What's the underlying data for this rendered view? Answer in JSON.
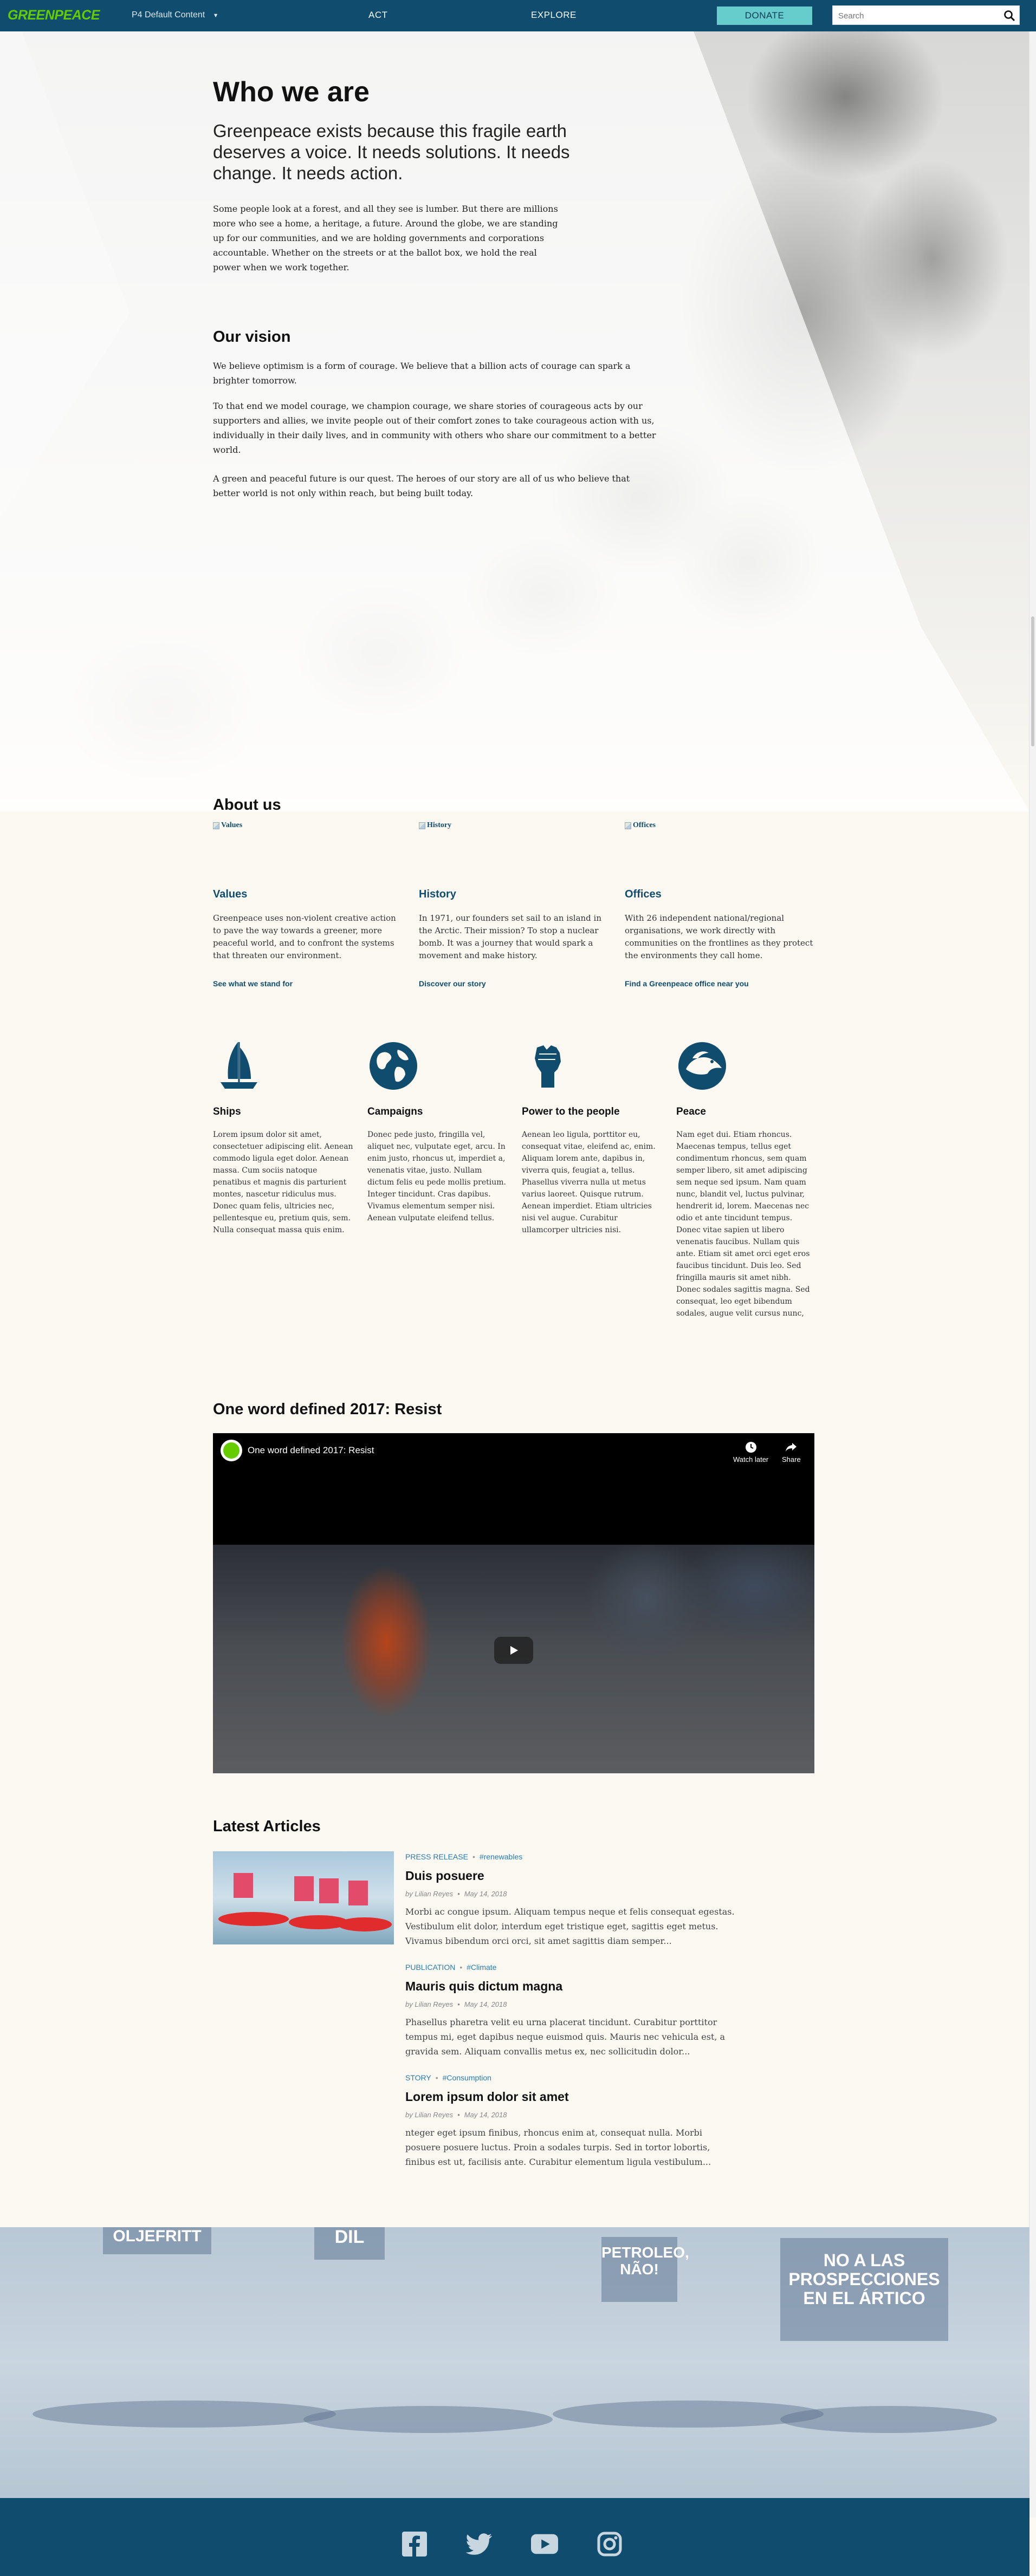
{
  "header": {
    "logo": "GREENPEACE",
    "site_switch": "P4 Default Content",
    "nav": [
      "ACT",
      "EXPLORE"
    ],
    "donate": "DONATE",
    "search_placeholder": "Search"
  },
  "hero": {
    "title": "Who we are",
    "lead": "Greenpeace exists because this fragile earth deserves a voice. It needs solutions. It needs change. It needs action.",
    "intro": "Some people look at a forest, and all they see is lumber. But there are millions more who see a home, a heritage, a future. Around the globe, we are standing up for our communities, and we are holding governments and corporations accountable. Whether on the streets or at the ballot box, we hold the real power when we work together."
  },
  "vision": {
    "heading": "Our vision",
    "paragraphs": [
      "We believe optimism is a form of courage. We believe that a billion acts of courage can spark a brighter tomorrow.",
      "To that end we model courage, we champion courage, we share stories of courageous acts by our supporters and allies, we invite people out of their comfort zones to take courageous action with us, individually in their daily lives, and in community with others who share our commitment to a better world.",
      "A green and peaceful future is our quest. The heroes of our story are all of us who believe that better world is not only within reach, but being built today."
    ]
  },
  "about": {
    "heading": "About us",
    "items": [
      {
        "img_alt": "Values",
        "title": "Values",
        "text": "Greenpeace uses non-violent creative action to pave the way towards a greener, more peaceful world, and to confront the systems that threaten our environment.",
        "link": "See what we stand for"
      },
      {
        "img_alt": "History",
        "title": "History",
        "text": "In 1971, our founders set sail to an island in the Arctic. Their mission? To stop a nuclear bomb. It was a journey that would spark a movement and make history.",
        "link": "Discover our story"
      },
      {
        "img_alt": "Offices",
        "title": "Offices",
        "text": "With 26 independent national/regional organisations, we work directly with communities on the frontlines as they protect the environments they call home.",
        "link": "Find a Greenpeace office near you"
      }
    ]
  },
  "features": [
    {
      "icon": "ship-icon",
      "title": "Ships",
      "text": "Lorem ipsum dolor sit amet, consectetuer adipiscing elit. Aenean commodo ligula eget dolor. Aenean massa. Cum sociis natoque penatibus et magnis dis parturient montes, nascetur ridiculus mus. Donec quam felis, ultricies nec, pellentesque eu, pretium quis, sem. Nulla consequat massa quis enim."
    },
    {
      "icon": "globe-icon",
      "title": "Campaigns",
      "text": "Donec pede justo, fringilla vel, aliquet nec, vulputate eget, arcu. In enim justo, rhoncus ut, imperdiet a, venenatis vitae, justo. Nullam dictum felis eu pede mollis pretium. Integer tincidunt. Cras dapibus. Vivamus elementum semper nisi. Aenean vulputate eleifend tellus."
    },
    {
      "icon": "fist-icon",
      "title": "Power to the people",
      "text": "Aenean leo ligula, porttitor eu, consequat vitae, eleifend ac, enim. Aliquam lorem ante, dapibus in, viverra quis, feugiat a, tellus. Phasellus viverra nulla ut metus varius laoreet. Quisque rutrum. Aenean imperdiet. Etiam ultricies nisi vel augue. Curabitur ullamcorper ultricies nisi."
    },
    {
      "icon": "dove-icon",
      "title": "Peace",
      "text": "Nam eget dui. Etiam rhoncus. Maecenas tempus, tellus eget condimentum rhoncus, sem quam semper libero, sit amet adipiscing sem neque sed ipsum. Nam quam nunc, blandit vel, luctus pulvinar, hendrerit id, lorem. Maecenas nec odio et ante tincidunt tempus. Donec vitae sapien ut libero venenatis faucibus. Nullam quis ante. Etiam sit amet orci eget eros faucibus tincidunt. Duis leo. Sed fringilla mauris sit amet nibh. Donec sodales sagittis magna. Sed consequat, leo eget bibendum sodales, augue velit cursus nunc,"
    }
  ],
  "video": {
    "heading": "One word defined 2017: Resist",
    "title": "One word defined 2017: Resist",
    "watch_later": "Watch later",
    "share": "Share"
  },
  "articles": {
    "heading": "Latest Articles",
    "items": [
      {
        "type": "PRESS RELEASE",
        "tag": "#renewables",
        "title": "Duis posuere",
        "author": "by Lilian Reyes",
        "date": "May 14, 2018",
        "excerpt": "Morbi ac congue ipsum. Aliquam tempus neque et felis consequat egestas. Vestibulum elit dolor, interdum eget tristique eget, sagittis eget metus. Vivamus bibendum orci orci, sit amet sagittis diam semper..."
      },
      {
        "type": "PUBLICATION",
        "tag": "#Climate",
        "title": "Mauris quis dictum magna",
        "author": "by Lilian Reyes",
        "date": "May 14, 2018",
        "excerpt": "Phasellus pharetra velit eu urna placerat tincidunt. Curabitur porttitor tempus mi, eget dapibus neque euismod quis. Mauris nec vehicula est, a gravida sem. Aliquam convallis metus ex, nec sollicitudin dolor..."
      },
      {
        "type": "STORY",
        "tag": "#Consumption",
        "title": "Lorem ipsum dolor sit amet",
        "author": "by Lilian Reyes",
        "date": "May 14, 2018",
        "excerpt": "nteger eget ipsum finibus, rhoncus enim at, consequat nulla. Morbi posuere posuere luctus. Proin a sodales turpis. Sed in tortor lobortis, finibus est ut, facilisis ante. Curabitur elementum ligula vestibulum..."
      }
    ]
  },
  "banner_signs": [
    "OLJEFRITT",
    "DIL",
    "PETROLEO, NÃO!",
    "NO A LAS PROSPECCIONES EN EL ÁRTICO"
  ],
  "footer": {
    "social": [
      "facebook-icon",
      "twitter-icon",
      "youtube-icon",
      "instagram-icon"
    ]
  },
  "colors": {
    "header": "#0f4c6e",
    "donate": "#66cccc",
    "logo": "#66cc00",
    "link": "#0f4c6e",
    "tag": "#2a7bb0"
  }
}
